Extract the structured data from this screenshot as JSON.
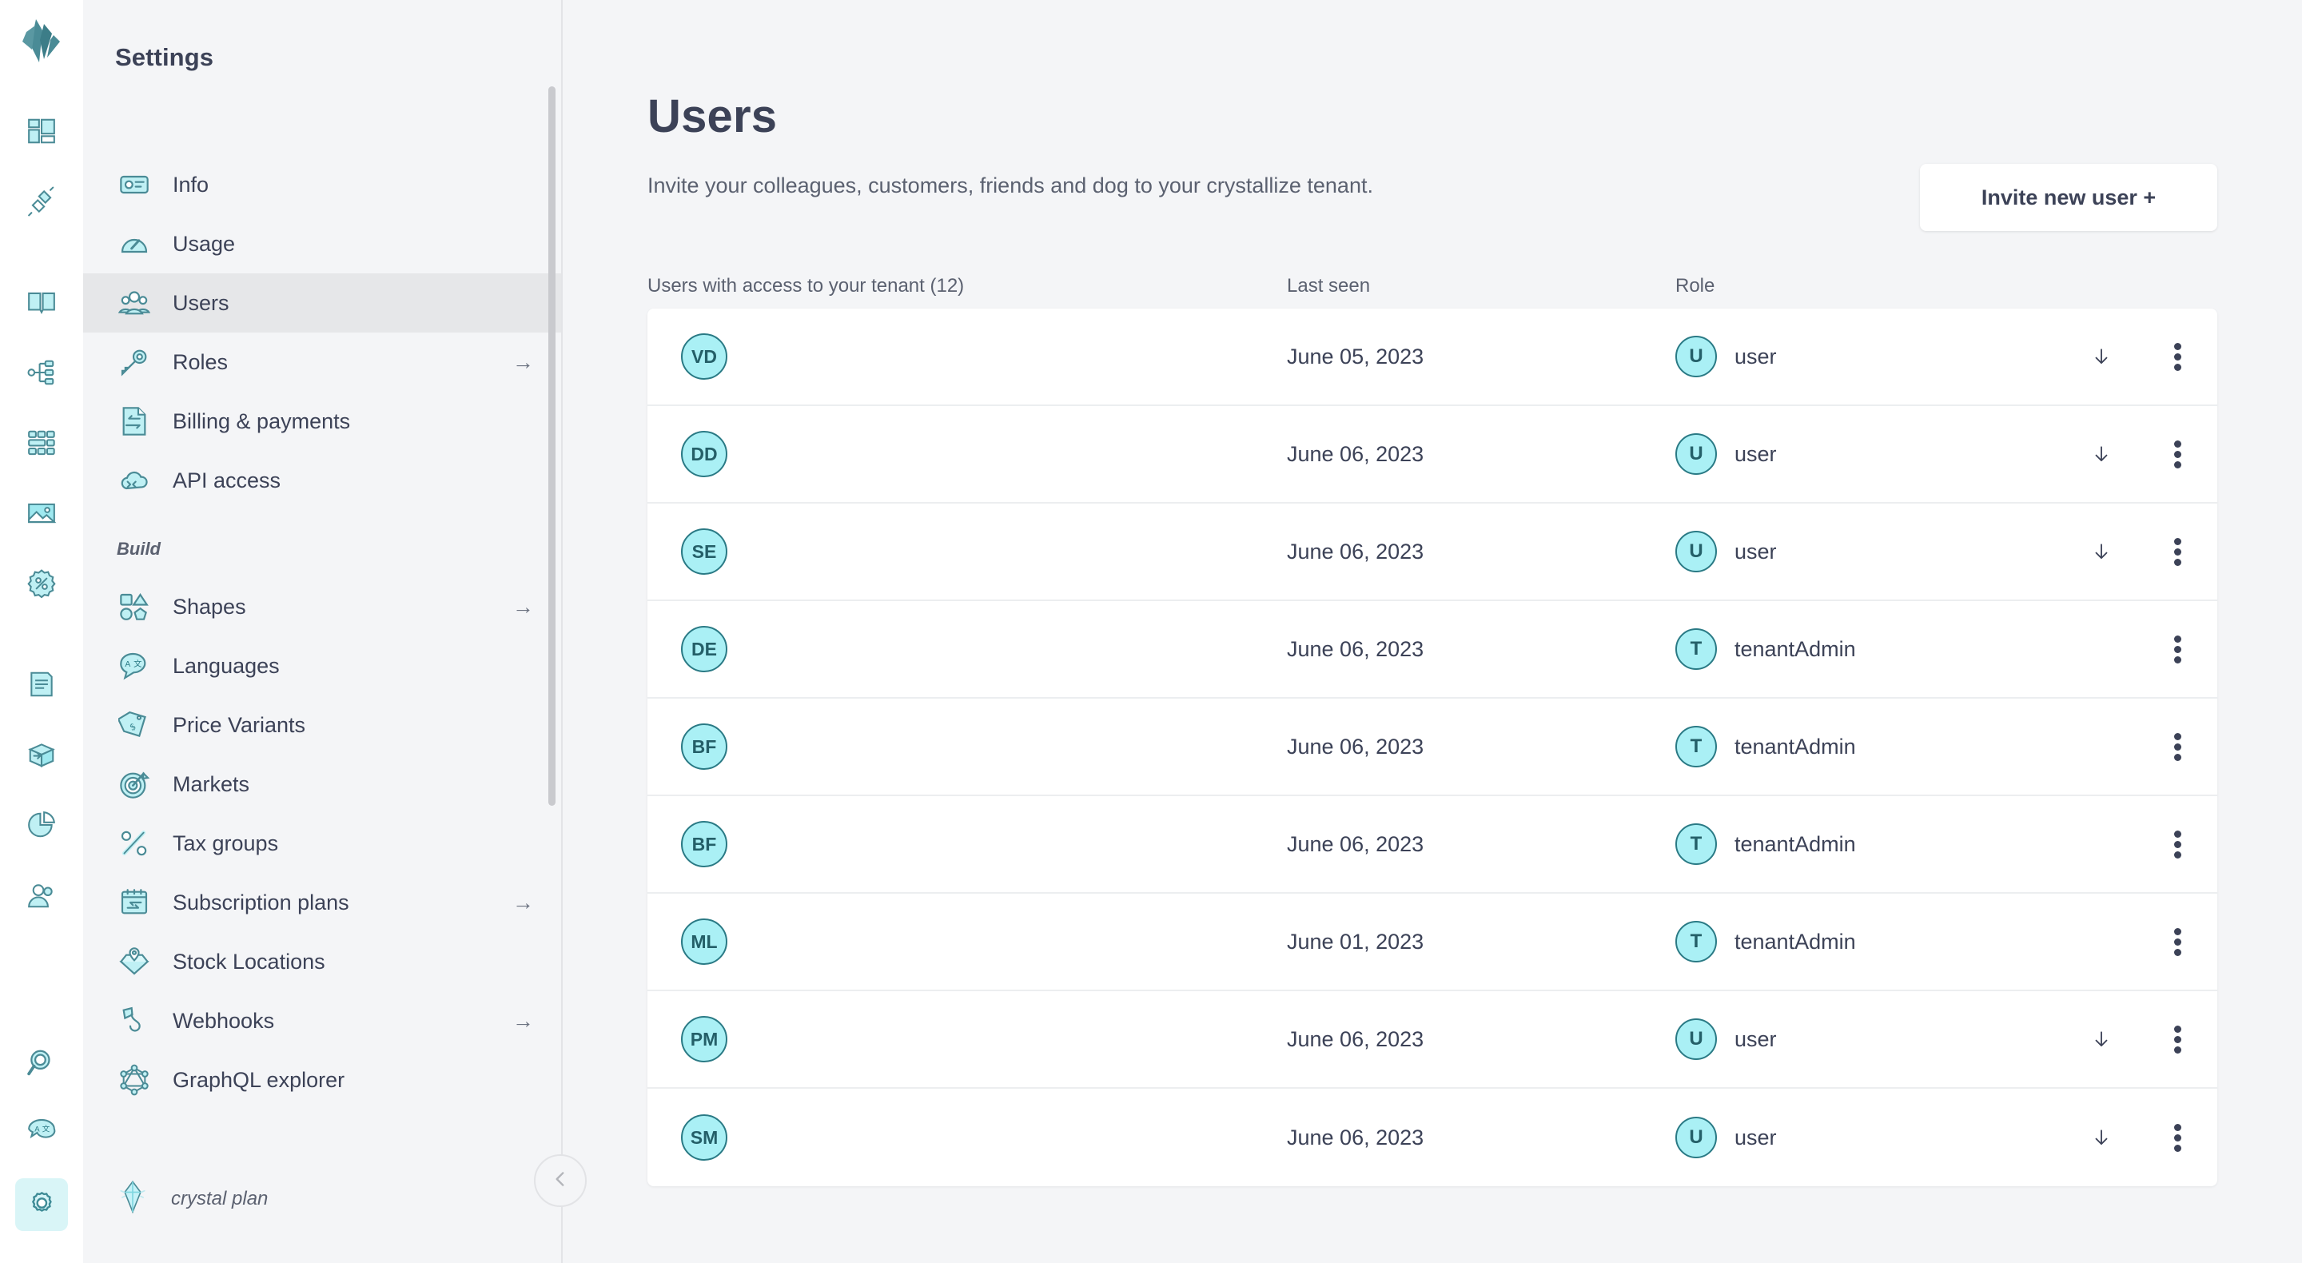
{
  "rail": {
    "logo": "crystallize-logo",
    "items": [
      {
        "icon": "dashboard-grid-icon",
        "name": "dashboard"
      },
      {
        "icon": "plug-connect-icon",
        "name": "connections"
      },
      {
        "icon": "book-catalogue-icon",
        "name": "catalogue"
      },
      {
        "icon": "hierarchy-tree-icon",
        "name": "topics"
      },
      {
        "icon": "grid-blocks-icon",
        "name": "grids"
      },
      {
        "icon": "image-media-icon",
        "name": "media"
      },
      {
        "icon": "discount-badge-icon",
        "name": "discounts"
      },
      {
        "icon": "clipboard-orders-icon",
        "name": "orders"
      },
      {
        "icon": "box-shipment-icon",
        "name": "shipments"
      },
      {
        "icon": "pie-chart-icon",
        "name": "analytics"
      },
      {
        "icon": "person-customer-icon",
        "name": "customers"
      },
      {
        "icon": "magnifier-search-icon",
        "name": "search"
      },
      {
        "icon": "translate-bubble-icon",
        "name": "translations"
      },
      {
        "icon": "gear-settings-icon",
        "name": "settings",
        "active": true
      }
    ]
  },
  "settings": {
    "title": "Settings",
    "nav": [
      {
        "label": "Info",
        "icon": "id-card-icon",
        "arrow": "",
        "active": false
      },
      {
        "label": "Usage",
        "icon": "gauge-icon",
        "arrow": "",
        "active": false
      },
      {
        "label": "Users",
        "icon": "users-group-icon",
        "arrow": "",
        "active": true
      },
      {
        "label": "Roles",
        "icon": "key-icon",
        "arrow": "→",
        "active": false
      },
      {
        "label": "Billing & payments",
        "icon": "invoice-icon",
        "arrow": "",
        "active": false
      },
      {
        "label": "API access",
        "icon": "cloud-api-icon",
        "arrow": "",
        "active": false
      }
    ],
    "section_build": "Build",
    "build_nav": [
      {
        "label": "Shapes",
        "icon": "shapes-icon",
        "arrow": "→"
      },
      {
        "label": "Languages",
        "icon": "language-bubble-icon",
        "arrow": ""
      },
      {
        "label": "Price Variants",
        "icon": "price-tag-icon",
        "arrow": ""
      },
      {
        "label": "Markets",
        "icon": "target-icon",
        "arrow": ""
      },
      {
        "label": "Tax groups",
        "icon": "percent-icon",
        "arrow": ""
      },
      {
        "label": "Subscription plans",
        "icon": "calendar-refresh-icon",
        "arrow": "→"
      },
      {
        "label": "Stock Locations",
        "icon": "box-pin-icon",
        "arrow": ""
      },
      {
        "label": "Webhooks",
        "icon": "hook-icon",
        "arrow": "→"
      },
      {
        "label": "GraphQL explorer",
        "icon": "graphql-icon",
        "arrow": ""
      }
    ],
    "plan_label": "crystal plan",
    "plan_icon": "crystal-gem-icon",
    "collapse_icon": "chevron-left-icon"
  },
  "main": {
    "title": "Users",
    "subtitle": "Invite your colleagues, customers, friends and dog to your crystallize tenant.",
    "invite_button": "Invite new user +",
    "table": {
      "headers": {
        "users": "Users with access to your tenant (12)",
        "last_seen": "Last seen",
        "role": "Role"
      },
      "rows": [
        {
          "initials": "VD",
          "last_seen": "June 05, 2023",
          "role_initial": "U",
          "role": "user",
          "has_download": true
        },
        {
          "initials": "DD",
          "last_seen": "June 06, 2023",
          "role_initial": "U",
          "role": "user",
          "has_download": true
        },
        {
          "initials": "SE",
          "last_seen": "June 06, 2023",
          "role_initial": "U",
          "role": "user",
          "has_download": true
        },
        {
          "initials": "DE",
          "last_seen": "June 06, 2023",
          "role_initial": "T",
          "role": "tenantAdmin",
          "has_download": false
        },
        {
          "initials": "BF",
          "last_seen": "June 06, 2023",
          "role_initial": "T",
          "role": "tenantAdmin",
          "has_download": false
        },
        {
          "initials": "BF",
          "last_seen": "June 06, 2023",
          "role_initial": "T",
          "role": "tenantAdmin",
          "has_download": false
        },
        {
          "initials": "ML",
          "last_seen": "June 01, 2023",
          "role_initial": "T",
          "role": "tenantAdmin",
          "has_download": false
        },
        {
          "initials": "PM",
          "last_seen": "June 06, 2023",
          "role_initial": "U",
          "role": "user",
          "has_download": true
        },
        {
          "initials": "SM",
          "last_seen": "June 06, 2023",
          "role_initial": "U",
          "role": "user",
          "has_download": true
        }
      ],
      "download_icon": "download-arrow-icon",
      "menu_icon": "kebab-menu-icon"
    }
  },
  "colors": {
    "accent": "#aaf0f5",
    "accent_border": "#2a7a85",
    "text": "#3c4257",
    "muted": "#5b6170",
    "panel": "#f4f5f7",
    "active_row": "#e6e7e9"
  }
}
